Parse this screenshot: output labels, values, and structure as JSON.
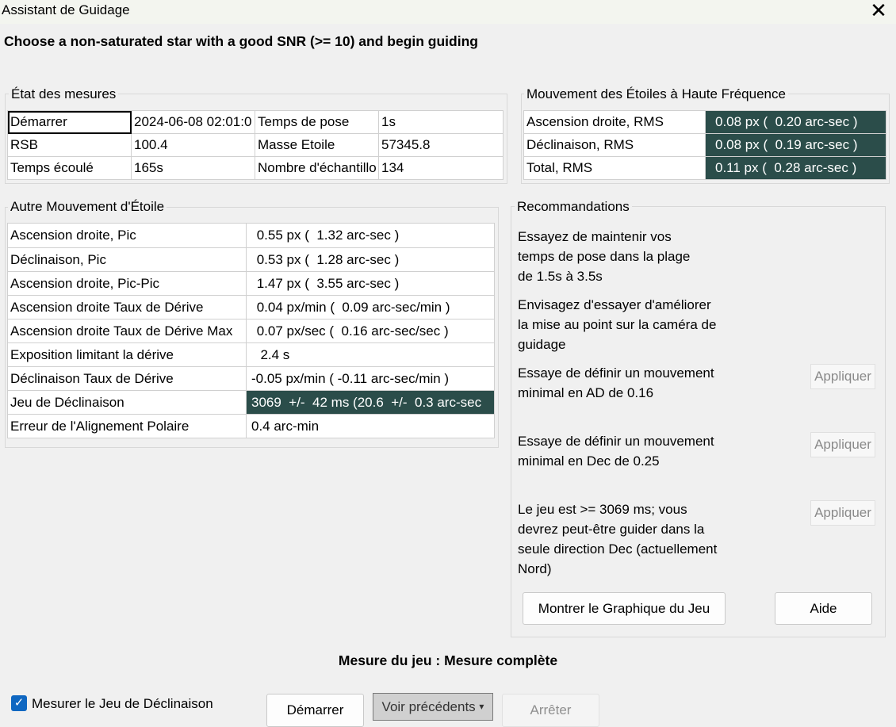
{
  "window": {
    "title": "Assistant de Guidage",
    "close_glyph": "✕"
  },
  "instruction": "Choose a non-saturated star with a good SNR (>= 10) and begin guiding",
  "measurement_status": {
    "title": "État des mesures",
    "rows": [
      [
        "Démarrer",
        "2024-06-08 02:01:0",
        "Temps de pose",
        "1s"
      ],
      [
        "RSB",
        "100.4",
        "Masse Etoile",
        "57345.8"
      ],
      [
        "Temps écoulé",
        "165s",
        "Nombre d'échantillo",
        "134"
      ]
    ]
  },
  "high_freq": {
    "title": "Mouvement des Étoiles à Haute Fréquence",
    "rows": [
      [
        "Ascension droite, RMS",
        "0.08 px (  0.20 arc-sec )"
      ],
      [
        "Déclinaison, RMS",
        "0.08 px (  0.19 arc-sec )"
      ],
      [
        "Total, RMS",
        "0.11 px (  0.28 arc-sec )"
      ]
    ]
  },
  "other_motion": {
    "title": "Autre Mouvement d'Étoile",
    "rows": [
      [
        "Ascension droite, Pic",
        " 0.55 px (  1.32 arc-sec )"
      ],
      [
        "Déclinaison, Pic",
        " 0.53 px (  1.28 arc-sec )"
      ],
      [
        "Ascension droite, Pic-Pic",
        " 1.47 px (  3.55 arc-sec )"
      ],
      [
        "Ascension droite Taux de Dérive",
        " 0.04 px/min (  0.09 arc-sec/min )"
      ],
      [
        "Ascension droite Taux de Dérive Max",
        " 0.07 px/sec (  0.16 arc-sec/sec )"
      ],
      [
        "Exposition limitant la dérive",
        "  2.4 s"
      ],
      [
        "Déclinaison Taux de Dérive",
        "-0.05 px/min ( -0.11 arc-sec/min )"
      ],
      [
        "Jeu de Déclinaison",
        "3069  +/-  42 ms (20.6  +/-  0.3 arc-sec"
      ],
      [
        "Erreur de l'Alignement Polaire",
        "0.4 arc-min"
      ]
    ]
  },
  "recommendations": {
    "title": "Recommandations",
    "items": [
      "Essayez de maintenir vos temps de pose dans la plage de 1.5s à 3.5s",
      "Envisagez d'essayer d'améliorer la mise au point sur la caméra de guidage",
      "Essaye de définir un mouvement minimal en AD de 0.16",
      "Essaye de définir un mouvement minimal en Dec de 0.25",
      "Le jeu est >= 3069 ms; vous devrez peut-être guider dans la seule direction Dec (actuellement Nord)"
    ],
    "apply_label": "Appliquer",
    "show_graph_label": "Montrer le Graphique du Jeu",
    "help_label": "Aide"
  },
  "status_text": "Mesure du jeu : Mesure complète",
  "bottom": {
    "checkbox_label": "Mesurer le Jeu de Déclinaison",
    "checkbox_checked": true,
    "check_glyph": "✓",
    "start_label": "Démarrer",
    "previous_label": "Voir précédents",
    "dropdown_glyph": "▾",
    "stop_label": "Arrêter"
  },
  "colors": {
    "highlight": "#2b4d4a",
    "checkbox": "#0f67c1"
  }
}
